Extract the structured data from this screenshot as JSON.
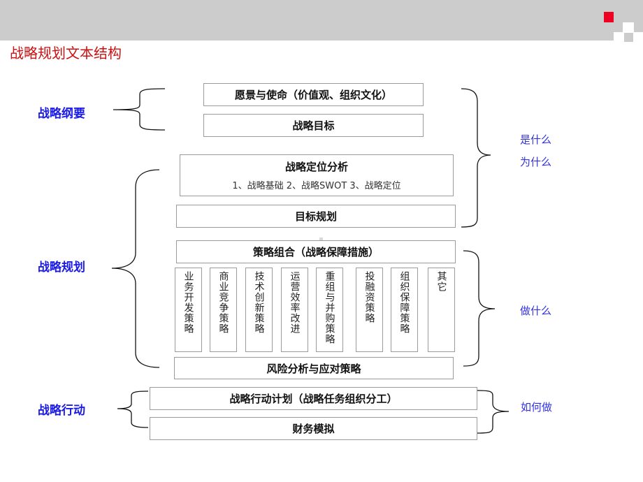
{
  "header": {
    "title": "战略规划文本结构",
    "title_color": "#cc1111",
    "bar_color": "#cccccc",
    "accent_square_color": "#ee0022"
  },
  "left_labels": {
    "outline": "战略纲要",
    "planning": "战略规划",
    "action": "战略行动"
  },
  "right_labels": {
    "what_line1": "是什么",
    "what_line2": "为什么",
    "do_what": "做什么",
    "how": "如何做"
  },
  "boxes": {
    "vision": "愿景与使命（价值观、组织文化）",
    "goal": "战略目标",
    "positioning_title": "战略定位分析",
    "positioning_sub": "1、战略基础   2、战略SWOT   3、战略定位",
    "target_planning": "目标规划",
    "strategy_mix": "策略组合（战略保障措施）",
    "risk": "风险分析与应对策略",
    "action_plan": "战略行动计划（战略任务组织分工）",
    "finance": "财务模拟"
  },
  "strategy_columns": [
    "业务开发策略",
    "商业竞争策略",
    "技术创新策略",
    "运营效率改进",
    "重组与并购策略",
    "投融资策略",
    "组织保障策略",
    "其它"
  ]
}
